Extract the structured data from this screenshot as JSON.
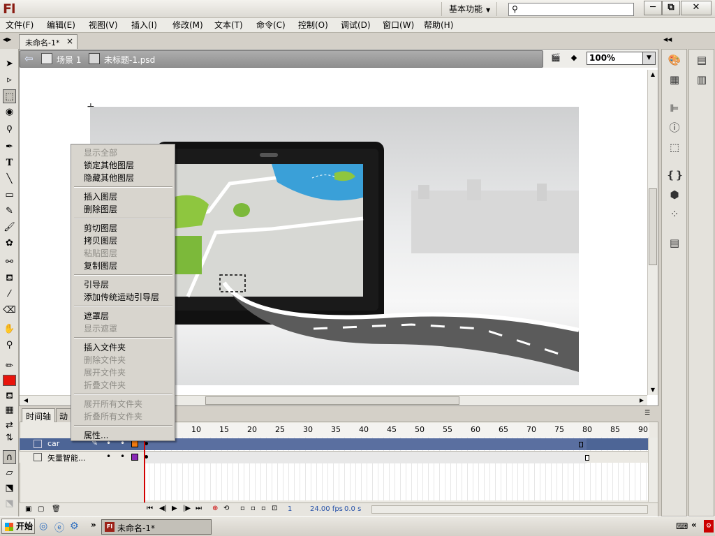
{
  "title_bar": {
    "app_logo": "Fl",
    "workspace": "基本功能",
    "search_placeholder": "",
    "minimize": "─",
    "restore": "⧉",
    "close": "✕"
  },
  "menus": [
    "文件(F)",
    "编辑(E)",
    "视图(V)",
    "插入(I)",
    "修改(M)",
    "文本(T)",
    "命令(C)",
    "控制(O)",
    "调试(D)",
    "窗口(W)",
    "帮助(H)"
  ],
  "document_tab": {
    "label": "未命名-1*",
    "close": "×"
  },
  "edit_bar": {
    "scene": "场景 1",
    "symbol": "未标题-1.psd",
    "zoom": "100%"
  },
  "timeline": {
    "tabs": [
      "时间轴",
      "动画编辑器"
    ],
    "ruler": [
      "10",
      "15",
      "20",
      "25",
      "30",
      "35",
      "40",
      "45",
      "50",
      "55",
      "60",
      "65",
      "70",
      "75",
      "80",
      "85",
      "90"
    ],
    "layers": [
      {
        "name": "car",
        "color": "#f07a10",
        "selected": true
      },
      {
        "name": "矢量智能...",
        "color": "#8a2ab6",
        "selected": false
      }
    ],
    "status": {
      "frame": "1",
      "fps": "24.00 fps",
      "time": "0.0 s"
    }
  },
  "context_menu": {
    "groups": [
      [
        {
          "label": "显示全部",
          "enabled": false
        },
        {
          "label": "锁定其他图层",
          "enabled": true
        },
        {
          "label": "隐藏其他图层",
          "enabled": true
        }
      ],
      [
        {
          "label": "插入图层",
          "enabled": true
        },
        {
          "label": "删除图层",
          "enabled": true
        }
      ],
      [
        {
          "label": "剪切图层",
          "enabled": true
        },
        {
          "label": "拷贝图层",
          "enabled": true
        },
        {
          "label": "粘贴图层",
          "enabled": false
        },
        {
          "label": "复制图层",
          "enabled": true
        }
      ],
      [
        {
          "label": "引导层",
          "enabled": true
        },
        {
          "label": "添加传统运动引导层",
          "enabled": true
        }
      ],
      [
        {
          "label": "遮罩层",
          "enabled": true
        },
        {
          "label": "显示遮罩",
          "enabled": false
        }
      ],
      [
        {
          "label": "插入文件夹",
          "enabled": true
        },
        {
          "label": "删除文件夹",
          "enabled": false
        },
        {
          "label": "展开文件夹",
          "enabled": false
        },
        {
          "label": "折叠文件夹",
          "enabled": false
        }
      ],
      [
        {
          "label": "展开所有文件夹",
          "enabled": false
        },
        {
          "label": "折叠所有文件夹",
          "enabled": false
        }
      ],
      [
        {
          "label": "属性...",
          "enabled": true
        }
      ]
    ]
  },
  "tools_panel": {
    "fill_color": "#e8140c"
  },
  "taskbar": {
    "start": "开始",
    "chevron": "»",
    "task": "未命名-1*",
    "task_icon": "Fl",
    "tray_chevron": "«"
  }
}
